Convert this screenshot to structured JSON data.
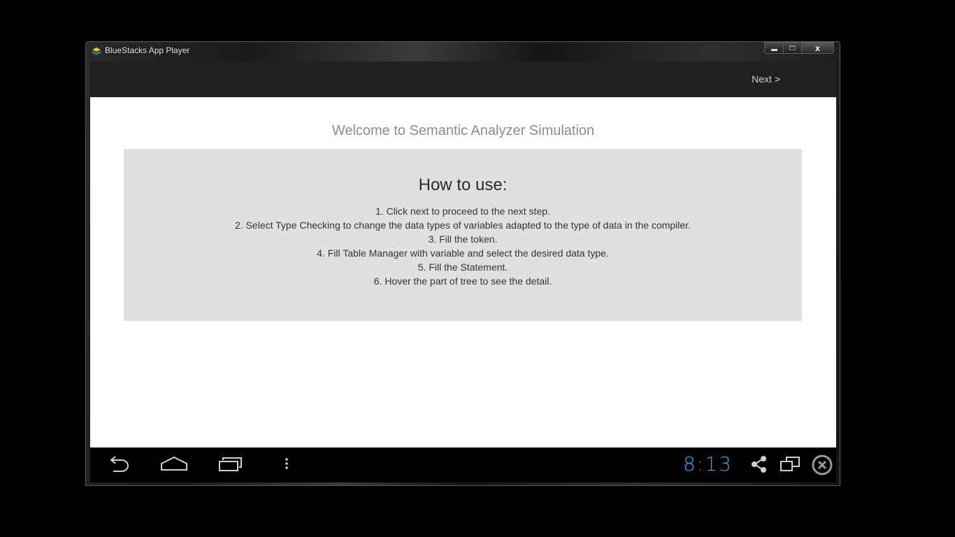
{
  "window": {
    "title": "BlueStacks App Player",
    "close_label": "x"
  },
  "actionbar": {
    "next_label": "Next >"
  },
  "main": {
    "welcome_title": "Welcome to Semantic Analyzer Simulation",
    "howto_heading": "How to use:",
    "steps": [
      "1. Click next to proceed to the next step.",
      "2. Select Type Checking to change the data types of variables adapted to the type of data in the compiler.",
      "3. Fill the token.",
      "4. Fill Table Manager with variable and select the desired data type.",
      "5. Fill the Statement.",
      "6. Hover the part of tree to see the detail."
    ]
  },
  "navbar": {
    "clock": "8:13",
    "icons": [
      "back-icon",
      "home-icon",
      "recent-apps-icon",
      "menu-icon",
      "share-icon",
      "resize-icon",
      "close-circle-icon"
    ]
  },
  "colors": {
    "actionbar_bg": "#202020",
    "howto_bg": "#e0e0e0",
    "clock": "#3aa6e0"
  }
}
